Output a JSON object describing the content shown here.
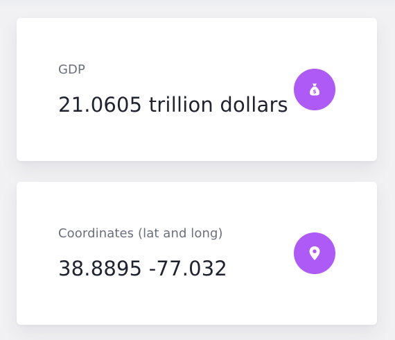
{
  "colors": {
    "accent": "#ad5af6",
    "card_background": "#ffffff",
    "page_background": "#f1f1f4",
    "label_text": "#6a6f7c",
    "value_text": "#1f2330"
  },
  "stats": [
    {
      "label": "GDP",
      "value": "21.0605 trillion dollars",
      "icon": "money-bag-icon",
      "icon_text": "$"
    },
    {
      "label": "Coordinates (lat and long)",
      "value": "38.8895 -77.032",
      "icon": "map-marker-icon"
    }
  ]
}
